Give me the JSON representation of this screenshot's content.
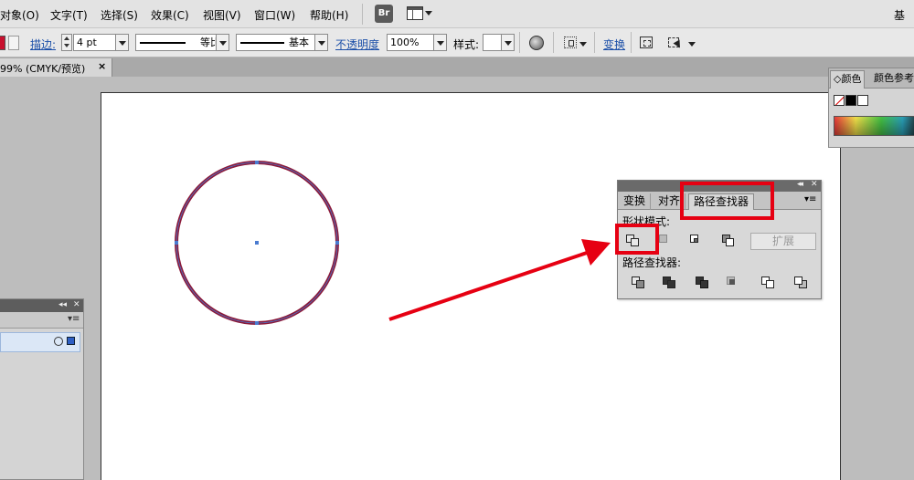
{
  "menubar": {
    "items": [
      "对象(O)",
      "文字(T)",
      "选择(S)",
      "效果(C)",
      "视图(V)",
      "窗口(W)",
      "帮助(H)"
    ],
    "bridge_label": "Br",
    "right_label": "基"
  },
  "controlbar": {
    "stroke_label": "描边:",
    "stroke_value": "4 pt",
    "profile_label": "等比",
    "brush_label": "基本",
    "opacity_label": "不透明度",
    "opacity_value": "100%",
    "style_label": "样式:",
    "transform_label": "变换",
    "fill_color": "#c8102e"
  },
  "document_tab": {
    "title": "99% (CMYK/预览)",
    "close": "×"
  },
  "color_panel": {
    "tab_active": "◇颜色",
    "tab_other": "颜色参考"
  },
  "pathfinder": {
    "tabs": [
      "变换",
      "对齐",
      "路径查找器"
    ],
    "active_tab": "路径查找器",
    "shape_modes_label": "形状模式:",
    "pathfinders_label": "路径查找器:",
    "expand_label": "扩展"
  },
  "shape": {
    "stroke_color": "#8b1a3a",
    "anchor_color": "#4a7bd0"
  },
  "annotations": {
    "highlight_color": "#e60012"
  }
}
